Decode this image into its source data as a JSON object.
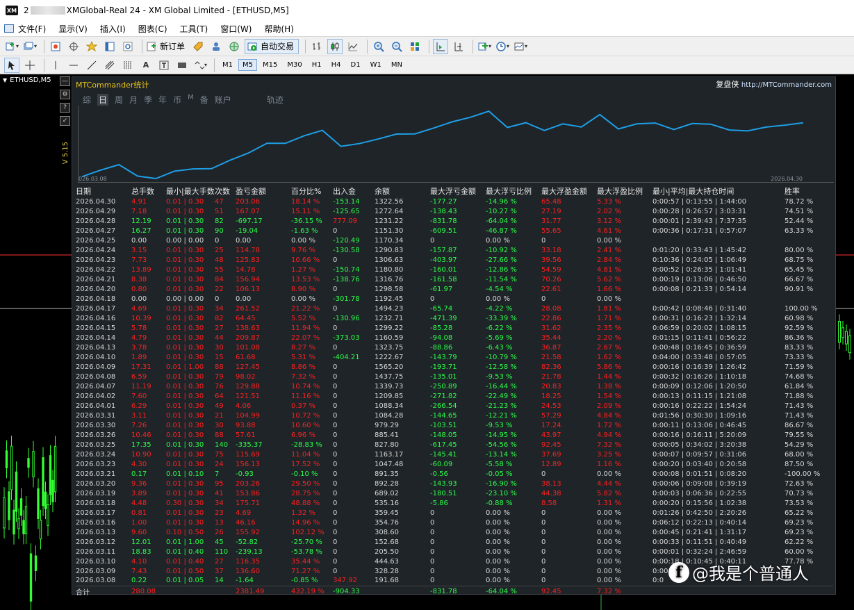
{
  "window": {
    "title_prefix": "2",
    "title": "XMGlobal-Real 24 - XM Global Limited - [ETHUSD,M5]",
    "app_icon": "XM"
  },
  "menu": [
    {
      "label": "文件(F)",
      "icon": "file-menu-icon"
    },
    {
      "label": "显示(V)",
      "icon": "view-menu-icon"
    },
    {
      "label": "插入(I)",
      "icon": "insert-menu-icon"
    },
    {
      "label": "图表(C)",
      "icon": "charts-menu-icon"
    },
    {
      "label": "工具(T)",
      "icon": "tools-menu-icon"
    },
    {
      "label": "窗口(W)",
      "icon": "window-menu-icon"
    },
    {
      "label": "帮助(H)",
      "icon": "help-menu-icon"
    }
  ],
  "toolbar": {
    "new_order": "新订单",
    "auto_trading": "自动交易"
  },
  "timeframes": [
    "M1",
    "M5",
    "M15",
    "M30",
    "H1",
    "H4",
    "D1",
    "W1",
    "MN"
  ],
  "active_timeframe": "M5",
  "chart_tab": "ETHUSD,M5",
  "version": "V 5.15",
  "panel": {
    "title": "MTCommander统计",
    "brand": "复盘侠",
    "url": "http://MTCommander.com",
    "tabs": [
      "综",
      "日",
      "周",
      "月",
      "季",
      "年",
      "币",
      "M",
      "备",
      "账户"
    ],
    "tab_track": "轨迹",
    "active_tab": "日",
    "curve_start": "026.03.08",
    "curve_end": "2026.04.30"
  },
  "table": {
    "headers": [
      "日期",
      "总手数",
      "最小|最大手数",
      "次数",
      "盈亏金额",
      "百分比%",
      "出入金",
      "余额",
      "最大浮亏金额",
      "最大浮亏比例",
      "最大浮盈金额",
      "最大浮盈比例",
      "最小|平均|最大持仓时间",
      "胜率"
    ],
    "rows": [
      [
        "2026.04.30",
        "4.91",
        "0.01 | 0.30",
        "47",
        "203.06",
        "18.14 %",
        "-153.14",
        "1322.56",
        "-177.27",
        "-14.96 %",
        "65.48",
        "5.33 %",
        "0:00:57 | 0:13:55 | 1:44:00",
        "78.72 %"
      ],
      [
        "2026.04.29",
        "7.18",
        "0.01 | 0.30",
        "51",
        "167.07",
        "15.11 %",
        "-125.65",
        "1272.64",
        "-138.43",
        "-10.27 %",
        "27.19",
        "2.02 %",
        "0:00:28 | 0:26:57 | 3:03:31",
        "74.51 %"
      ],
      [
        "2026.04.28",
        "12.19",
        "0.01 | 0.30",
        "82",
        "-697.17",
        "-36.15 %",
        "777.09",
        "1231.22",
        "-831.78",
        "-64.04 %",
        "31.77",
        "3.12 %",
        "0:00:01 | 2:39:43 | 7:37:35",
        "52.44 %"
      ],
      [
        "2026.04.27",
        "16.27",
        "0.01 | 0.30",
        "90",
        "-19.04",
        "-1.63 %",
        "0",
        "1151.30",
        "-609.51",
        "-46.87 %",
        "55.65",
        "4.61 %",
        "0:00:36 | 0:17:31 | 0:57:07",
        "63.33 %"
      ],
      [
        "2026.04.25",
        "0.00",
        "0.00 | 0.00",
        "0",
        "0.00",
        "0.00 %",
        "-120.49",
        "1170.34",
        "0",
        "0.00 %",
        "0",
        "0.00 %",
        "",
        ""
      ],
      [
        "2026.04.24",
        "3.15",
        "0.01 | 0.30",
        "25",
        "114.78",
        "9.76 %",
        "-130.58",
        "1290.83",
        "-157.87",
        "-10.92 %",
        "33.18",
        "2.41 %",
        "0:01:20 | 0:33:43 | 1:45:42",
        "80.00 %"
      ],
      [
        "2026.04.23",
        "7.73",
        "0.01 | 0.30",
        "48",
        "125.83",
        "10.66 %",
        "0",
        "1306.63",
        "-403.97",
        "-27.66 %",
        "39.56",
        "2.84 %",
        "0:10:36 | 0:24:05 | 1:06:49",
        "68.75 %"
      ],
      [
        "2026.04.22",
        "13.89",
        "0.01 | 0.30",
        "55",
        "14.78",
        "1.27 %",
        "-150.74",
        "1180.80",
        "-160.01",
        "-12.86 %",
        "54.59",
        "4.81 %",
        "0:00:52 | 0:26:35 | 1:01:41",
        "65.45 %"
      ],
      [
        "2026.04.21",
        "8.38",
        "0.01 | 0.30",
        "84",
        "156.94",
        "13.53 %",
        "-138.76",
        "1316.76",
        "-161.58",
        "-11.54 %",
        "70.26",
        "5.62 %",
        "0:00:19 | 0:13:06 | 0:46:50",
        "66.67 %"
      ],
      [
        "2026.04.20",
        "0.80",
        "0.01 | 0.30",
        "22",
        "106.13",
        "8.90 %",
        "0",
        "1298.58",
        "-61.97",
        "-4.54 %",
        "22.61",
        "1.66 %",
        "0:00:08 | 0:21:33 | 0:54:14",
        "90.91 %"
      ],
      [
        "2026.04.18",
        "0.00",
        "0.00 | 0.00",
        "0",
        "0.00",
        "0.00 %",
        "-301.78",
        "1192.45",
        "0",
        "0.00 %",
        "0",
        "0.00 %",
        "",
        ""
      ],
      [
        "2026.04.17",
        "4.69",
        "0.01 | 0.30",
        "34",
        "261.52",
        "21.22 %",
        "0",
        "1494.23",
        "-65.74",
        "-4.22 %",
        "28.08",
        "1.81 %",
        "0:00:42 | 0:08:46 | 0:31:40",
        "100.00 %"
      ],
      [
        "2026.04.16",
        "10.39",
        "0.01 | 0.30",
        "82",
        "64.45",
        "5.52 %",
        "-130.96",
        "1232.71",
        "-471.39",
        "-33.39 %",
        "22.86",
        "1.71 %",
        "0:00:31 | 0:16:23 | 1:32:14",
        "60.98 %"
      ],
      [
        "2026.04.15",
        "5.78",
        "0.01 | 0.30",
        "27",
        "138.63",
        "11.94 %",
        "0",
        "1299.22",
        "-85.28",
        "-6.22 %",
        "31.62",
        "2.35 %",
        "0:06:59 | 0:20:02 | 1:08:15",
        "92.59 %"
      ],
      [
        "2026.04.14",
        "4.79",
        "0.01 | 0.30",
        "44",
        "209.87",
        "22.07 %",
        "-373.03",
        "1160.59",
        "-94.08",
        "-5.69 %",
        "35.44",
        "2.20 %",
        "0:01:15 | 0:11:41 | 0:56:22",
        "86.36 %"
      ],
      [
        "2026.04.13",
        "3.78",
        "0.01 | 0.30",
        "30",
        "101.08",
        "8.27 %",
        "0",
        "1323.75",
        "-88.86",
        "-6.43 %",
        "36.87",
        "2.67 %",
        "0:00:48 | 0:16:45 | 0:36:59",
        "83.33 %"
      ],
      [
        "2026.04.10",
        "1.89",
        "0.01 | 0.30",
        "15",
        "61.68",
        "5.31 %",
        "-404.21",
        "1222.67",
        "-143.79",
        "-10.79 %",
        "21.58",
        "1.62 %",
        "0:04:00 | 0:33:48 | 0:57:05",
        "73.33 %"
      ],
      [
        "2026.04.09",
        "17.31",
        "0.01 | 1.00",
        "88",
        "127.45",
        "8.86 %",
        "0",
        "1565.20",
        "-193.71",
        "-12.58 %",
        "82.36",
        "5.86 %",
        "0:00:16 | 0:16:39 | 1:26:42",
        "71.59 %"
      ],
      [
        "2026.04.08",
        "6.59",
        "0.01 | 0.30",
        "79",
        "98.02",
        "7.32 %",
        "0",
        "1437.75",
        "-135.01",
        "-9.53 %",
        "21.78",
        "1.44 %",
        "0:00:32 | 0:16:26 | 1:10:18",
        "74.68 %"
      ],
      [
        "2026.04.07",
        "11.19",
        "0.01 | 0.30",
        "76",
        "129.88",
        "10.74 %",
        "0",
        "1339.73",
        "-250.89",
        "-16.44 %",
        "20.83",
        "1.38 %",
        "0:00:09 | 0:12:06 | 1:20:50",
        "61.84 %"
      ],
      [
        "2026.04.02",
        "7.60",
        "0.01 | 0.30",
        "64",
        "121.51",
        "11.16 %",
        "0",
        "1209.85",
        "-271.82",
        "-22.49 %",
        "18.25",
        "1.54 %",
        "0:00:13 | 0:11:15 | 1:21:08",
        "71.88 %"
      ],
      [
        "2026.04.01",
        "6.29",
        "0.01 | 0.30",
        "49",
        "4.06",
        "0.37 %",
        "0",
        "1088.34",
        "-266.54",
        "-21.23 %",
        "24.53",
        "2.09 %",
        "0:00:16 | 0:22:22 | 1:54:24",
        "71.43 %"
      ],
      [
        "2026.03.31",
        "3.11",
        "0.01 | 0.30",
        "21",
        "104.99",
        "10.72 %",
        "0",
        "1084.28",
        "-144.65",
        "-12.21 %",
        "57.29",
        "4.84 %",
        "0:01:56 | 0:30:30 | 1:09:16",
        "71.43 %"
      ],
      [
        "2026.03.30",
        "7.26",
        "0.01 | 0.30",
        "30",
        "93.88",
        "10.60 %",
        "0",
        "979.29",
        "-103.51",
        "-9.53 %",
        "17.24",
        "1.72 %",
        "0:00:11 | 0:13:06 | 0:46:45",
        "86.67 %"
      ],
      [
        "2026.03.26",
        "10.46",
        "0.01 | 0.30",
        "88",
        "57.61",
        "6.96 %",
        "0",
        "885.41",
        "-148.05",
        "-14.95 %",
        "43.97",
        "4.94 %",
        "0:00:16 | 0:16:11 | 5:20:09",
        "79.55 %"
      ],
      [
        "2026.03.25",
        "17.35",
        "0.01 | 0.30",
        "140",
        "-335.37",
        "-28.83 %",
        "0",
        "827.80",
        "-617.45",
        "-54.56 %",
        "92.45",
        "7.32 %",
        "0:00:05 | 0:34:02 | 3:20:38",
        "54.29 %"
      ],
      [
        "2026.03.24",
        "10.90",
        "0.01 | 0.30",
        "75",
        "115.69",
        "11.04 %",
        "0",
        "1163.17",
        "-145.41",
        "-13.14 %",
        "37.69",
        "3.25 %",
        "0:00:07 | 0:09:57 | 0:31:06",
        "68.00 %"
      ],
      [
        "2026.03.23",
        "4.30",
        "0.01 | 0.30",
        "24",
        "156.13",
        "17.52 %",
        "0",
        "1047.48",
        "-60.09",
        "-5.58 %",
        "12.89",
        "1.16 %",
        "0:00:20 | 0:03:40 | 0:20:58",
        "87.50 %"
      ],
      [
        "2026.03.21",
        "0.17",
        "0.01 | 0.10",
        "7",
        "-0.93",
        "-0.10 %",
        "0",
        "891.35",
        "-0.56",
        "-0.05 %",
        "0",
        "0.00 %",
        "0:00:08 | 0:01:51 | 0:08:20",
        "-100.00 %"
      ],
      [
        "2026.03.20",
        "9.36",
        "0.01 | 0.30",
        "95",
        "203.26",
        "29.50 %",
        "0",
        "892.28",
        "-143.93",
        "-16.90 %",
        "38.13",
        "4.44 %",
        "0:00:06 | 0:09:08 | 0:39:19",
        "72.63 %"
      ],
      [
        "2026.03.19",
        "3.89",
        "0.01 | 0.30",
        "41",
        "153.86",
        "28.75 %",
        "0",
        "689.02",
        "-180.51",
        "-23.10 %",
        "44.38",
        "5.82 %",
        "0:00:03 | 0:06:36 | 0:22:55",
        "70.73 %"
      ],
      [
        "2026.03.18",
        "4.48",
        "0.30 | 0.30",
        "34",
        "175.71",
        "48.88 %",
        "0",
        "535.16",
        "-5.86",
        "-0.88 %",
        "8.58",
        "1.31 %",
        "0:00:20 | 0:15:56 | 1:02:38",
        "73.53 %"
      ],
      [
        "2026.03.17",
        "0.81",
        "0.01 | 0.30",
        "23",
        "4.69",
        "1.32 %",
        "0",
        "359.45",
        "0",
        "0.00 %",
        "0",
        "0.00 %",
        "0:01:26 | 0:42:50 | 2:20:26",
        "65.22 %"
      ],
      [
        "2026.03.16",
        "1.00",
        "0.01 | 0.30",
        "13",
        "46.16",
        "14.96 %",
        "0",
        "354.76",
        "0",
        "0.00 %",
        "0",
        "0.00 %",
        "0:06:12 | 0:22:13 | 0:40:14",
        "69.23 %"
      ],
      [
        "2026.03.13",
        "9.60",
        "0.10 | 0.50",
        "26",
        "155.92",
        "102.12 %",
        "0",
        "308.60",
        "0",
        "0.00 %",
        "0",
        "0.00 %",
        "0:00:45 | 0:21:41 | 1:31:17",
        "69.23 %"
      ],
      [
        "2026.03.12",
        "12.01",
        "0.01 | 1.00",
        "45",
        "-52.82",
        "-25.70 %",
        "0",
        "152.68",
        "0",
        "0.00 %",
        "0",
        "0.00 %",
        "0:00:33 | 0:11:51 | 0:40:49",
        "62.22 %"
      ],
      [
        "2026.03.11",
        "18.83",
        "0.01 | 0.40",
        "110",
        "-239.13",
        "-53.78 %",
        "0",
        "205.50",
        "0",
        "0.00 %",
        "0",
        "0.00 %",
        "0:00:01 | 0:32:24 | 2:46:59",
        "60.00 %"
      ],
      [
        "2026.03.10",
        "4.10",
        "0.01 | 0.40",
        "27",
        "116.35",
        "35.44 %",
        "0",
        "444.63",
        "0",
        "0.00 %",
        "0",
        "0.00 %",
        "0:00:18 | 0:10:45 | 0:40:11",
        "77.78 %"
      ],
      [
        "2026.03.09",
        "7.43",
        "0.01 | 0.50",
        "37",
        "136.60",
        "71.27 %",
        "0",
        "328.28",
        "0",
        "0.00 %",
        "0",
        "0.00 %",
        "0:00:",
        ""
      ],
      [
        "2026.03.08",
        "0.22",
        "0.01 | 0.05",
        "14",
        "-1.64",
        "-0.85 %",
        "347.92",
        "191.68",
        "0",
        "0.00 %",
        "0",
        "0.00 %",
        "0:0",
        ""
      ]
    ],
    "total": [
      "合计",
      "280.08",
      "",
      "",
      "2381.49",
      "432.19 %",
      "-904.33",
      "",
      "-831.78",
      "-64.04 %",
      "92.45",
      "7.32 %",
      "",
      ""
    ]
  },
  "watermark": "@我是个普通人",
  "colors": {
    "curve": "#1e9ee6",
    "profit_red": "#ff2020",
    "loss_green": "#2aff4a",
    "panel_bg": "#1f2428",
    "title_yellow": "#e6c21a"
  }
}
